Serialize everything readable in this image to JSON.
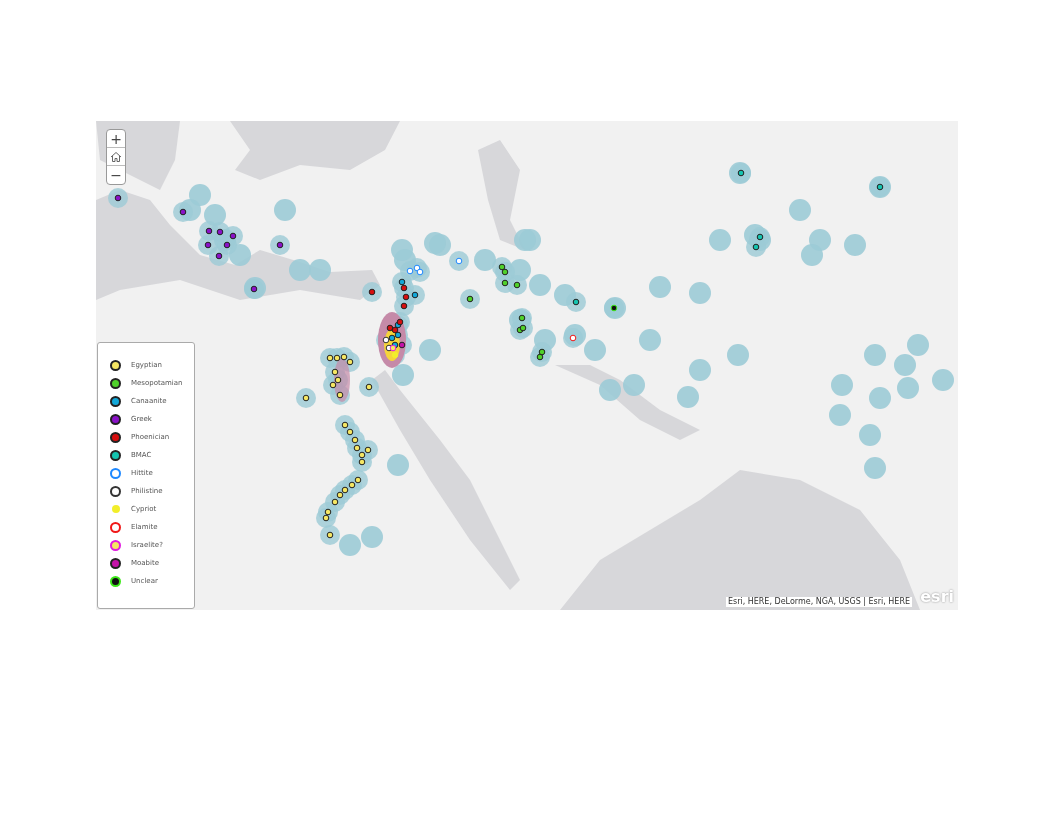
{
  "map_controls": {
    "zoom_in": "+",
    "zoom_out": "−"
  },
  "legend": [
    {
      "label": "Egyptian",
      "color": "#f5e663",
      "border": {
        "color": "#222222"
      }
    },
    {
      "label": "Mesopotamian",
      "color": "#4fd12a",
      "border": {
        "color": "#222222"
      }
    },
    {
      "label": "Canaanite",
      "color": "#12a7d8",
      "border": {
        "color": "#222222"
      }
    },
    {
      "label": "Greek",
      "color": "#8a12c8",
      "border": {
        "color": "#222222"
      }
    },
    {
      "label": "Phoenician",
      "color": "#d60f0f",
      "border": {
        "color": "#222222"
      }
    },
    {
      "label": "BMAC",
      "color": "#14c4b0",
      "border": {
        "color": "#222222"
      }
    },
    {
      "label": "Hittite",
      "color": "#ffffff",
      "border": {
        "color": "#1e88ff"
      }
    },
    {
      "label": "Philistine",
      "color": "#ffffff",
      "border": {
        "color": "#333333"
      }
    },
    {
      "label": "Cypriot",
      "color": "#f2ee2a"
    },
    {
      "label": "Elamite",
      "color": "#ffffff",
      "border": {
        "color": "#f01818"
      }
    },
    {
      "label": "Israelite?",
      "color": "#f5e663",
      "border": {
        "color": "#e018e0"
      }
    },
    {
      "label": "Moabite",
      "color": "#c412a8",
      "border": {
        "color": "#222222"
      }
    },
    {
      "label": "Unclear",
      "color": "#111111",
      "border": {
        "color": "#3ee81a"
      }
    }
  ],
  "attribution": "Esri, HERE, DeLorme, NGA, USGS | Esri, HERE",
  "logo": "esri"
}
